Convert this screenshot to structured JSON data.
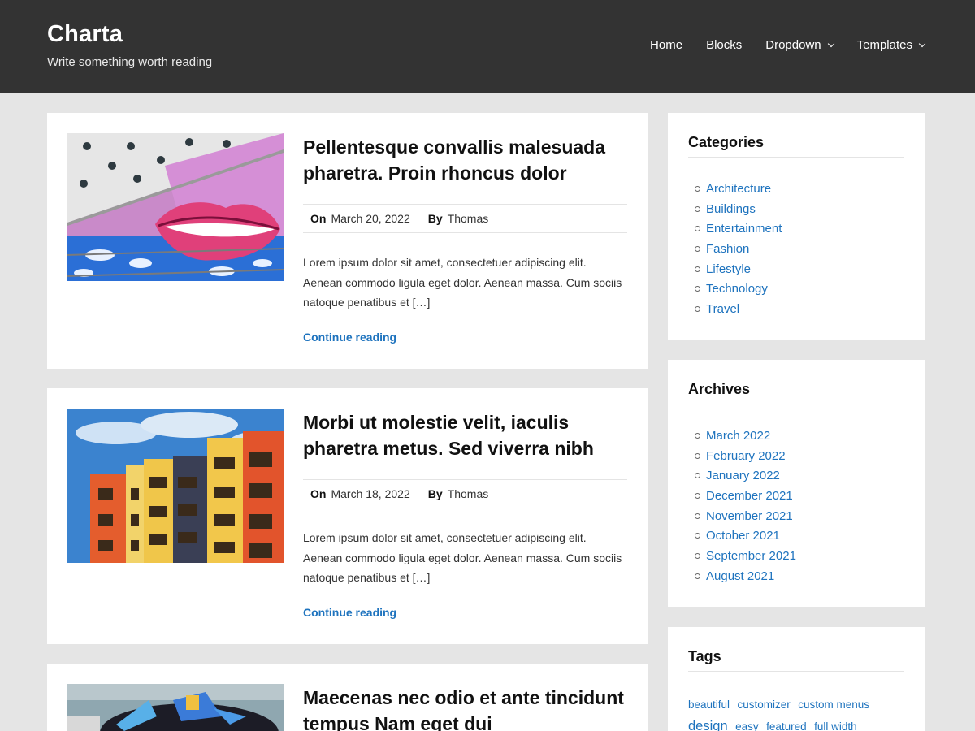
{
  "site": {
    "title": "Charta",
    "description": "Write something worth reading"
  },
  "nav": {
    "items": [
      {
        "label": "Home"
      },
      {
        "label": "Blocks"
      },
      {
        "label": "Dropdown"
      },
      {
        "label": "Templates"
      }
    ]
  },
  "posts": [
    {
      "title": "Pellentesque convallis malesuada pharetra. Proin rhoncus dolor",
      "on_label": "On",
      "date": "March 20, 2022",
      "by_label": "By",
      "author": "Thomas",
      "excerpt": "Lorem ipsum dolor sit amet, consectetuer adipiscing elit. Aenean commodo ligula eget dolor. Aenean massa. Cum sociis natoque penatibus et […]",
      "continue_label": "Continue reading"
    },
    {
      "title": "Morbi ut molestie velit, iaculis pharetra metus. Sed viverra nibh",
      "on_label": "On",
      "date": "March 18, 2022",
      "by_label": "By",
      "author": "Thomas",
      "excerpt": "Lorem ipsum dolor sit amet, consectetuer adipiscing elit. Aenean commodo ligula eget dolor. Aenean massa. Cum sociis natoque penatibus et […]",
      "continue_label": "Continue reading"
    },
    {
      "title": "Maecenas nec odio et ante tincidunt tempus Nam eget dui"
    }
  ],
  "sidebar": {
    "categories": {
      "title": "Categories",
      "items": [
        "Architecture",
        "Buildings",
        "Entertainment",
        "Fashion",
        "Lifestyle",
        "Technology",
        "Travel"
      ]
    },
    "archives": {
      "title": "Archives",
      "items": [
        "March 2022",
        "February 2022",
        "January 2022",
        "December 2021",
        "November 2021",
        "October 2021",
        "September 2021",
        "August 2021"
      ]
    },
    "tags": {
      "title": "Tags",
      "items": [
        "beautiful",
        "customizer",
        "custom menus",
        "design",
        "easy",
        "featured",
        "full width"
      ]
    }
  },
  "colors": {
    "header_bg": "#333333",
    "page_bg": "#e5e5e5",
    "link": "#1e73be"
  }
}
